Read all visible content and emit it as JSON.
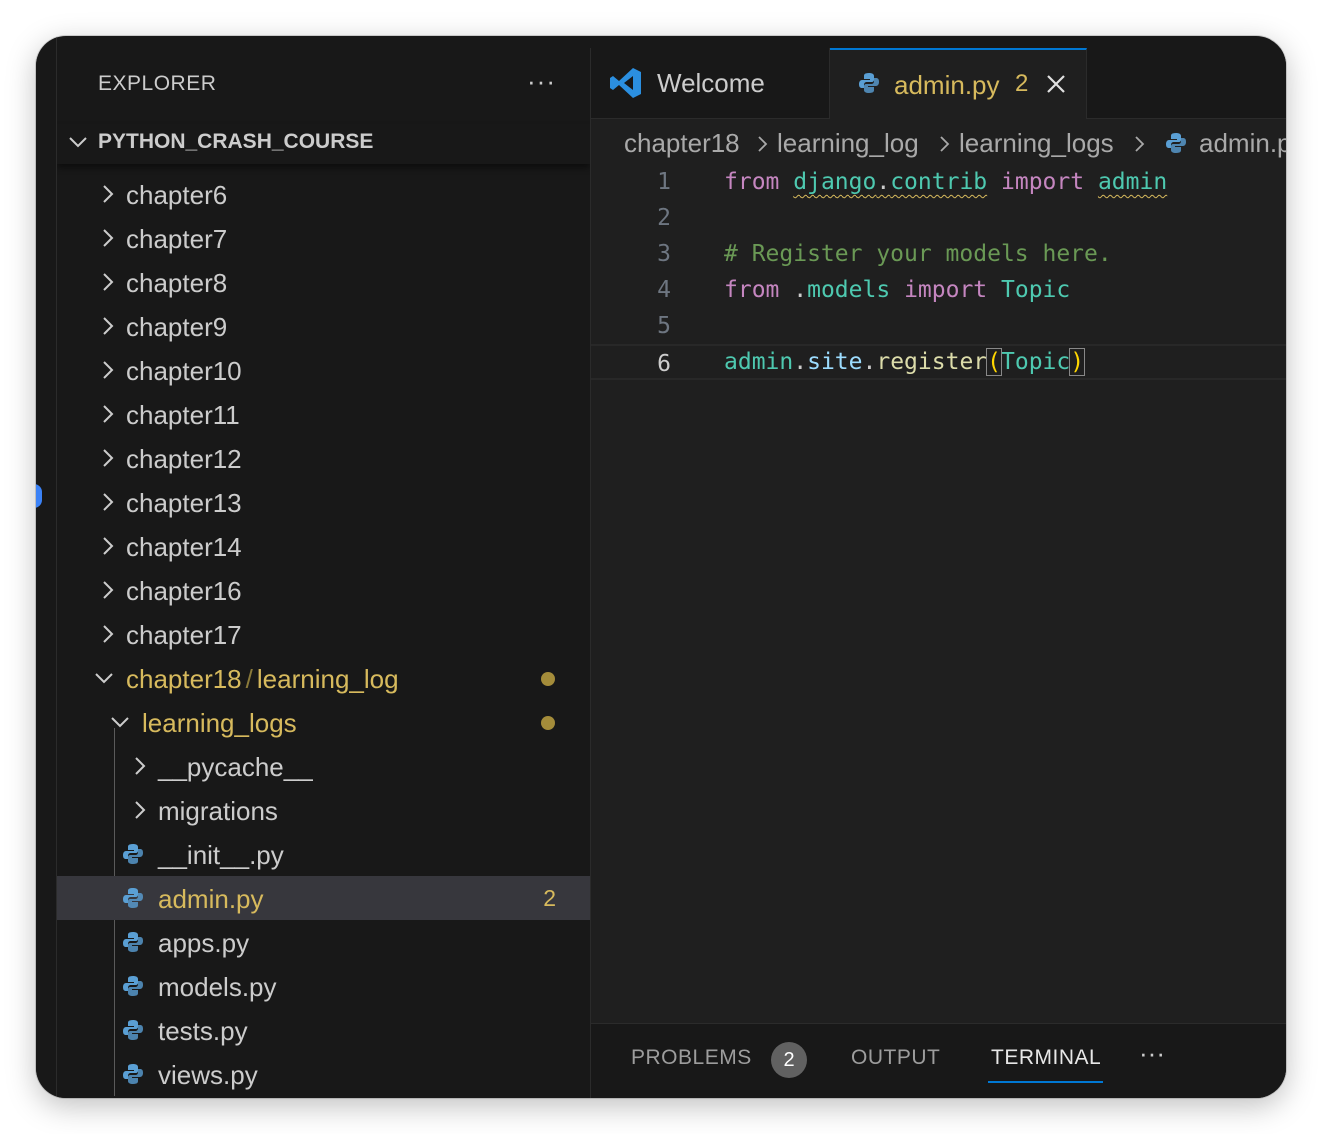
{
  "explorer": {
    "title": "EXPLORER",
    "more": "···",
    "root": "PYTHON_CRASH_COURSE",
    "folders": [
      {
        "label": "chapter6"
      },
      {
        "label": "chapter7"
      },
      {
        "label": "chapter8"
      },
      {
        "label": "chapter9"
      },
      {
        "label": "chapter10"
      },
      {
        "label": "chapter11"
      },
      {
        "label": "chapter12"
      },
      {
        "label": "chapter13"
      },
      {
        "label": "chapter14"
      },
      {
        "label": "chapter16"
      },
      {
        "label": "chapter17"
      }
    ],
    "open_folder": {
      "part1": "chapter18",
      "sep": "/",
      "part2": "learning_log"
    },
    "subfolder": "learning_logs",
    "children": [
      {
        "label": "__pycache__"
      },
      {
        "label": "migrations"
      },
      {
        "label": "__init__.py"
      },
      {
        "label": "admin.py",
        "count": "2"
      },
      {
        "label": "apps.py"
      },
      {
        "label": "models.py"
      },
      {
        "label": "tests.py"
      },
      {
        "label": "views.py"
      }
    ]
  },
  "tabs": {
    "welcome": "Welcome",
    "active": "admin.py",
    "active_count": "2"
  },
  "breadcrumb": [
    "chapter18",
    "learning_log",
    "learning_logs",
    "admin.py"
  ],
  "code": {
    "line_numbers": [
      "1",
      "2",
      "3",
      "4",
      "5",
      "6"
    ],
    "l1": {
      "kw1": "from",
      "mod1": "django",
      "dot": ".",
      "mod2": "contrib",
      "kw2": "import",
      "name": "admin"
    },
    "l3": {
      "comment": "# Register your models here."
    },
    "l4": {
      "kw1": "from",
      "dot": ".",
      "mod": "models",
      "kw2": "import",
      "name": "Topic"
    },
    "l6": {
      "obj": "admin",
      "dot1": ".",
      "attr": "site",
      "dot2": ".",
      "fn": "register",
      "lp": "(",
      "arg": "Topic",
      "rp": ")"
    }
  },
  "panel": {
    "problems": "PROBLEMS",
    "problems_count": "2",
    "output": "OUTPUT",
    "terminal": "TERMINAL",
    "more": "···"
  },
  "colors": {
    "accent": "#0078d4",
    "modified": "#d7ba5d",
    "keyword": "#c586c0",
    "module": "#4ec9b0",
    "function": "#dcdcaa",
    "comment": "#6a9955"
  }
}
